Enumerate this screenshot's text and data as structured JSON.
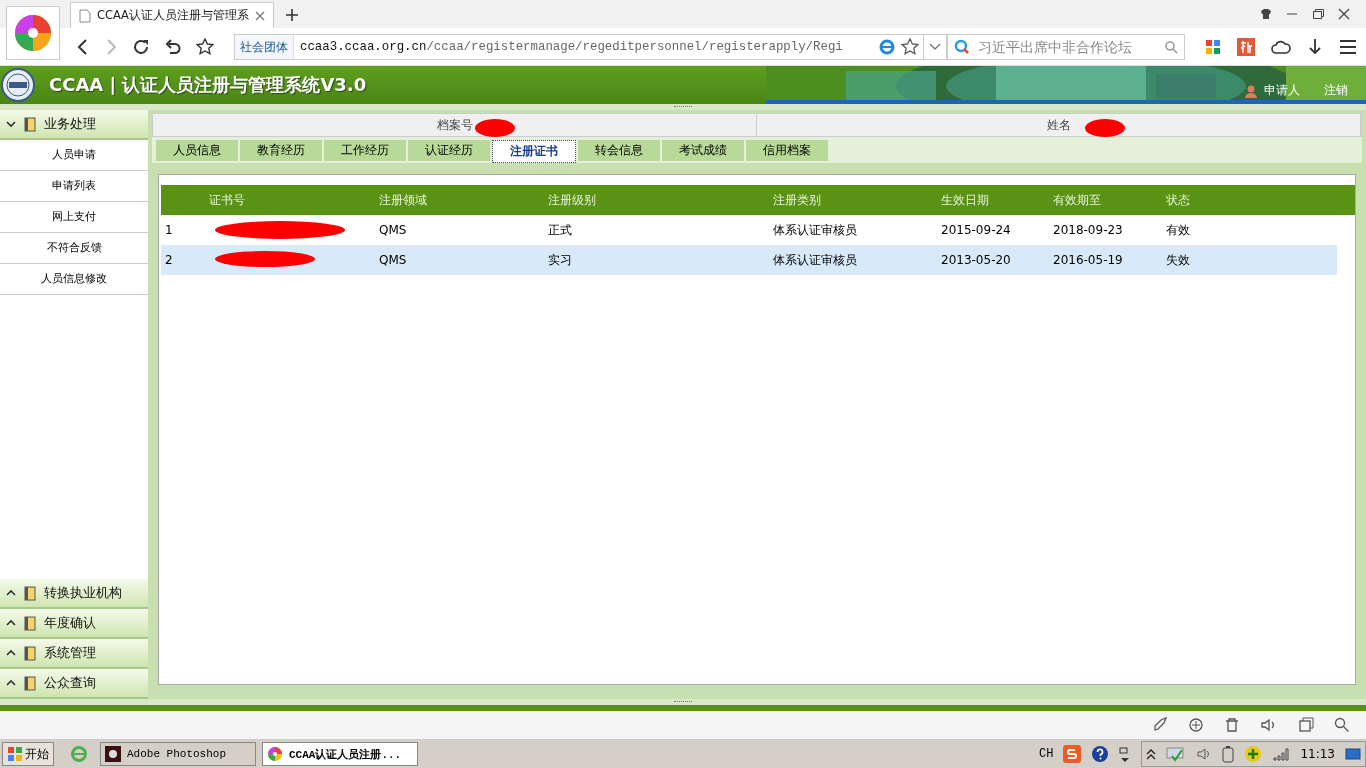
{
  "browser": {
    "tab_title": "CCAA认证人员注册与管理系",
    "address_badge": "社会团体",
    "url_host": "ccaa3.ccaa.org.cn",
    "url_path": "/ccaa/registermanage/regeditpersonnel/registerapply/Regi",
    "search_placeholder": "习近平出席中非合作论坛"
  },
  "app": {
    "title": "CCAA | 认证人员注册与管理系统V3.0",
    "user_links": [
      "申请人",
      "注销"
    ]
  },
  "sidebar": [
    {
      "label": "业务处理",
      "expanded": true,
      "items": [
        "人员申请",
        "申请列表",
        "网上支付",
        "不符合反馈",
        "人员信息修改"
      ]
    },
    {
      "label": "转换执业机构",
      "expanded": false
    },
    {
      "label": "年度确认",
      "expanded": false
    },
    {
      "label": "系统管理",
      "expanded": false
    },
    {
      "label": "公众查询",
      "expanded": false
    }
  ],
  "info": [
    {
      "label": "档案号"
    },
    {
      "label": "姓名"
    }
  ],
  "tabs": [
    {
      "label": "人员信息",
      "selected": false
    },
    {
      "label": "教育经历",
      "selected": false
    },
    {
      "label": "工作经历",
      "selected": false
    },
    {
      "label": "认证经历",
      "selected": false
    },
    {
      "label": "注册证书",
      "selected": true
    },
    {
      "label": "转会信息",
      "selected": false
    },
    {
      "label": "考试成绩",
      "selected": false
    },
    {
      "label": "信用档案",
      "selected": false
    }
  ],
  "table": {
    "columns": [
      "证书号",
      "注册领域",
      "注册级别",
      "注册类别",
      "生效日期",
      "有效期至",
      "状态"
    ],
    "rows": [
      {
        "index": "1",
        "domain": "QMS",
        "level": "正式",
        "category": "体系认证审核员",
        "start": "2015-09-24",
        "end": "2018-09-23",
        "status": "有效",
        "selected": false
      },
      {
        "index": "2",
        "domain": "QMS",
        "level": "实习",
        "category": "体系认证审核员",
        "start": "2013-05-20",
        "end": "2016-05-19",
        "status": "失效",
        "selected": true
      }
    ]
  },
  "taskbar": {
    "start": "开始",
    "tasks": [
      {
        "label": "Adobe Photoshop",
        "selected": false
      },
      {
        "label": "CCAA认证人员注册...",
        "selected": true
      }
    ],
    "lang": "CH",
    "clock": "11:13"
  }
}
